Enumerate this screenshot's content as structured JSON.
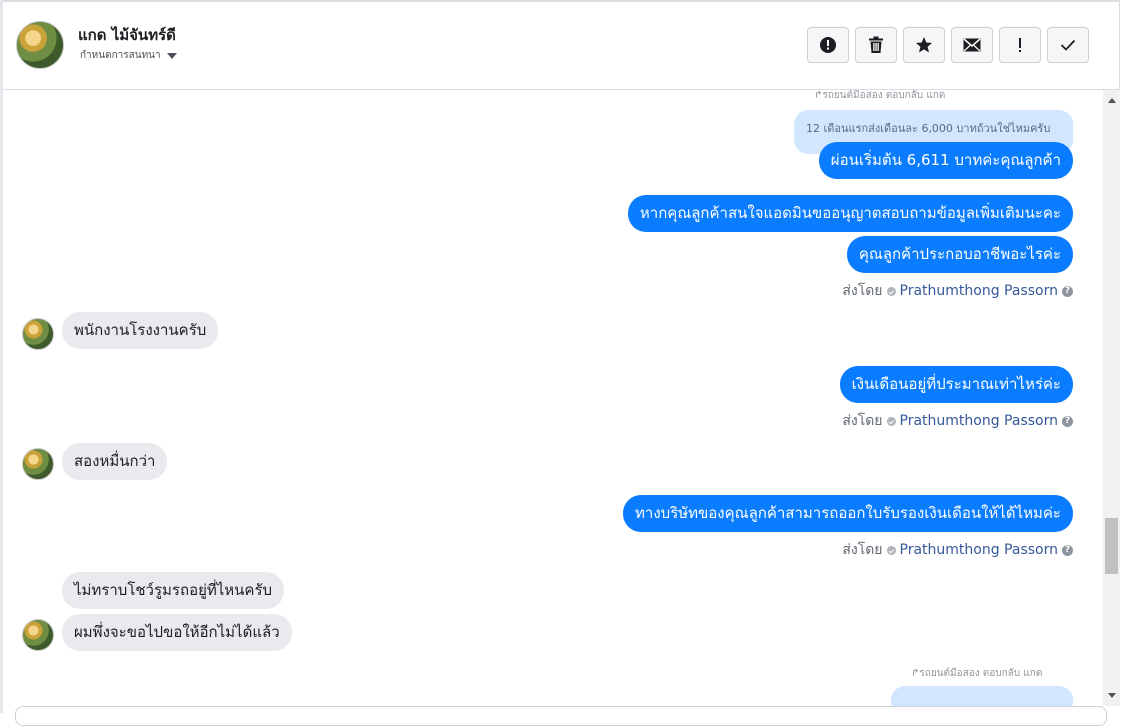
{
  "header": {
    "name": "แกด ไม้จันทร์ดี",
    "subtitle": "กำหนดการสนทนา",
    "toolbar": [
      {
        "icon": "alert-circle-icon"
      },
      {
        "icon": "trash-icon"
      },
      {
        "icon": "star-icon"
      },
      {
        "icon": "envelope-icon"
      },
      {
        "icon": "exclamation-icon"
      },
      {
        "icon": "check-icon"
      }
    ]
  },
  "conversation": {
    "reply_label_top": "รถยนต์มือสอง ตอบกลับ แกด",
    "reply_quote_top": "12 เดือนแรกส่งเดือนละ 6,000 บาทถ้วนใช่ไหมครับ",
    "msg_out_1": "ผ่อนเริ่มต้น 6,611 บาทค่ะคุณลูกค้า",
    "msg_out_2": "หากคุณลูกค้าสนใจแอดมินขออนุญาตสอบถามข้อมูลเพิ่มเติมนะคะ",
    "msg_out_3": "คุณลูกค้าประกอบอาชีพอะไรค่ะ",
    "sent_by_label": "ส่งโดย",
    "sent_by_name": "Prathumthong Passorn",
    "msg_in_1": "พนักงานโรงงานครับ",
    "msg_out_4": "เงินเดือนอยู่ที่ประมาณเท่าไหร่ค่ะ",
    "msg_in_2": "สองหมื่นกว่า",
    "msg_out_5": "ทางบริษัทของคุณลูกค้าสามารถออกใบรับรองเงินเดือนให้ได้ไหมค่ะ",
    "msg_in_3": "ไม่ทราบโชว์รูมรถอยู่ที่ไหนครับ",
    "msg_in_4": "ผมพึ่งจะขอไปขอให้อีกไม่ได้แล้ว",
    "reply_label_bottom": "รถยนต์มือสอง ตอบกลับ แกด"
  },
  "colors": {
    "outgoing_bubble": "#0a7cff",
    "incoming_bubble": "#e9eaed",
    "reply_quote": "#d2e6fd",
    "sender_name": "#365899"
  }
}
